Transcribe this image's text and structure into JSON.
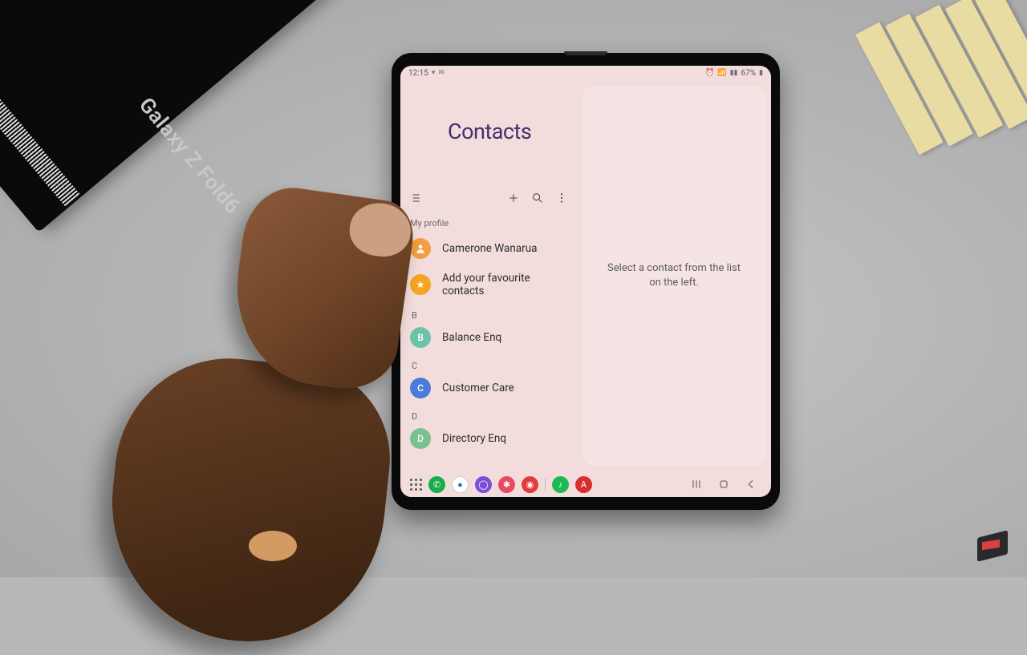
{
  "status": {
    "time": "12:15",
    "battery": "67%"
  },
  "app_title": "Contacts",
  "sections": {
    "my_profile": {
      "label": "My profile",
      "name": "Camerone Wanarua"
    },
    "fav": {
      "label": "Add your favourite contacts"
    },
    "b": {
      "header": "B",
      "name": "Balance Enq"
    },
    "c": {
      "header": "C",
      "name": "Customer Care"
    },
    "d": {
      "header": "D",
      "name": "Directory Enq"
    }
  },
  "right_pane": {
    "line1": "Select a contact from the list",
    "line2": "on the left."
  },
  "box_label": "Galaxy Z Fold6"
}
